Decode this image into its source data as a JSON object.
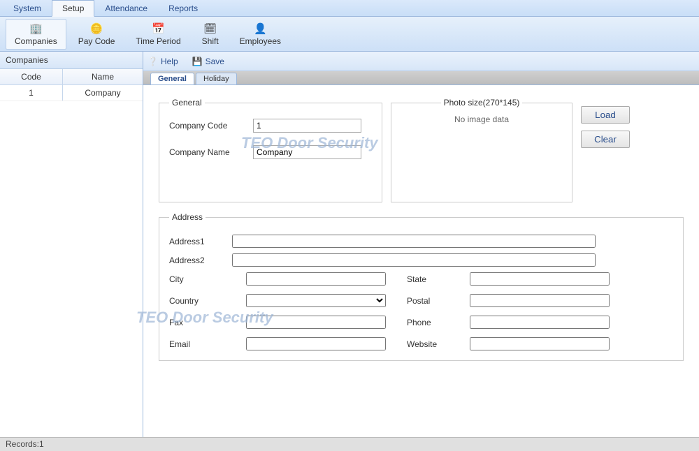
{
  "menu": {
    "items": [
      "System",
      "Setup",
      "Attendance",
      "Reports"
    ],
    "active": 1
  },
  "toolbar": {
    "items": [
      {
        "label": "Companies",
        "icon": "🏢"
      },
      {
        "label": "Pay Code",
        "icon": "🪙"
      },
      {
        "label": "Time Period",
        "icon": "📅"
      },
      {
        "label": "Shift",
        "icon": "🗓"
      },
      {
        "label": "Employees",
        "icon": "👤"
      }
    ],
    "active": 0
  },
  "sidebar": {
    "title": "Companies",
    "columns": {
      "code": "Code",
      "name": "Name"
    },
    "rows": [
      {
        "code": "1",
        "name": "Company"
      }
    ]
  },
  "actions": {
    "help": "Help",
    "save": "Save"
  },
  "tabs": {
    "items": [
      "General",
      "Holiday"
    ],
    "active": 0
  },
  "form": {
    "general_legend": "General",
    "company_code_label": "Company Code",
    "company_code_value": "1",
    "company_name_label": "Company Name",
    "company_name_value": "Company",
    "photo_legend": "Photo size(270*145)",
    "no_image": "No image data",
    "load_btn": "Load",
    "clear_btn": "Clear",
    "address_legend": "Address",
    "address1_label": "Address1",
    "address1_value": "",
    "address2_label": "Address2",
    "address2_value": "",
    "city_label": "City",
    "city_value": "",
    "state_label": "State",
    "state_value": "",
    "country_label": "Country",
    "country_value": "",
    "postal_label": "Postal",
    "postal_value": "",
    "fax_label": "Fax",
    "fax_value": "",
    "phone_label": "Phone",
    "phone_value": "",
    "email_label": "Email",
    "email_value": "",
    "website_label": "Website",
    "website_value": ""
  },
  "status": {
    "records_label": "Records:",
    "records_count": "1"
  },
  "watermark": "TEO Door Security"
}
